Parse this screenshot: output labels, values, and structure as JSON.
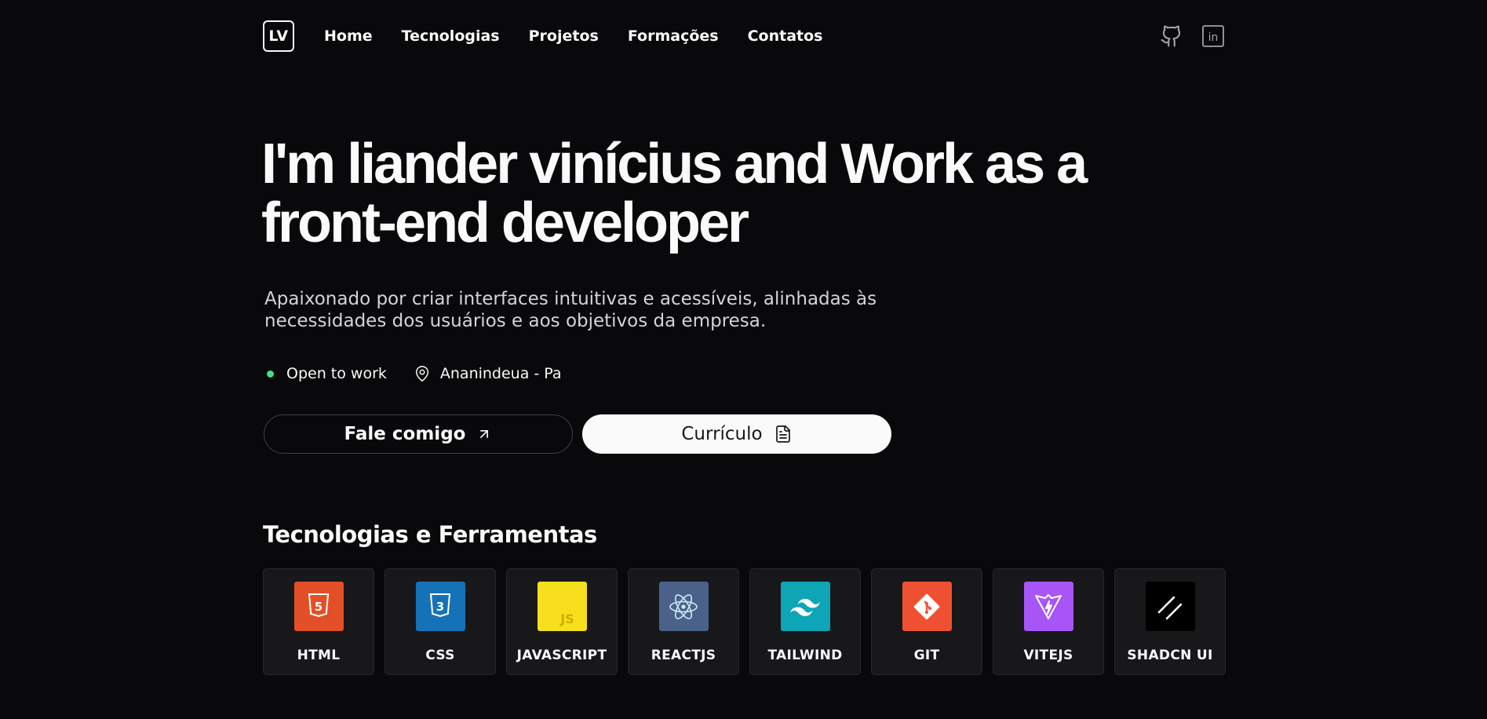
{
  "nav": {
    "logo": "LV",
    "links": [
      "Home",
      "Tecnologias",
      "Projetos",
      "Formações",
      "Contatos"
    ],
    "icons": [
      "github-icon",
      "linkedin-icon"
    ]
  },
  "hero": {
    "title_line1": "I'm liander vinícius and Work as a",
    "title_line2": "front-end developer",
    "subtitle_line1": "Apaixonado por criar interfaces intuitivas e acessíveis, alinhadas às",
    "subtitle_line2": "necessidades dos usuários e aos objetivos da empresa.",
    "status": "Open to work",
    "status_color": "#4ade80",
    "location": "Ananindeua - Pa",
    "cta_talk": "Fale comigo",
    "cta_cv": "Currículo"
  },
  "tech": {
    "title": "Tecnologias e Ferramentas",
    "items": [
      {
        "label": "HTML",
        "icon": "html5-icon",
        "color": "#e34f26"
      },
      {
        "label": "CSS",
        "icon": "css3-icon",
        "color": "#1572b6"
      },
      {
        "label": "JAVASCRIPT",
        "icon": "javascript-icon",
        "color": "#f7df1e"
      },
      {
        "label": "REACTJS",
        "icon": "react-icon",
        "color": "#4a6289"
      },
      {
        "label": "TAILWIND",
        "icon": "tailwind-icon",
        "color": "#0ea5b7"
      },
      {
        "label": "GIT",
        "icon": "git-icon",
        "color": "#f05032"
      },
      {
        "label": "VITEJS",
        "icon": "vite-icon",
        "color": "#a855f7"
      },
      {
        "label": "SHADCN UI",
        "icon": "shadcn-icon",
        "color": "#000000"
      }
    ]
  }
}
